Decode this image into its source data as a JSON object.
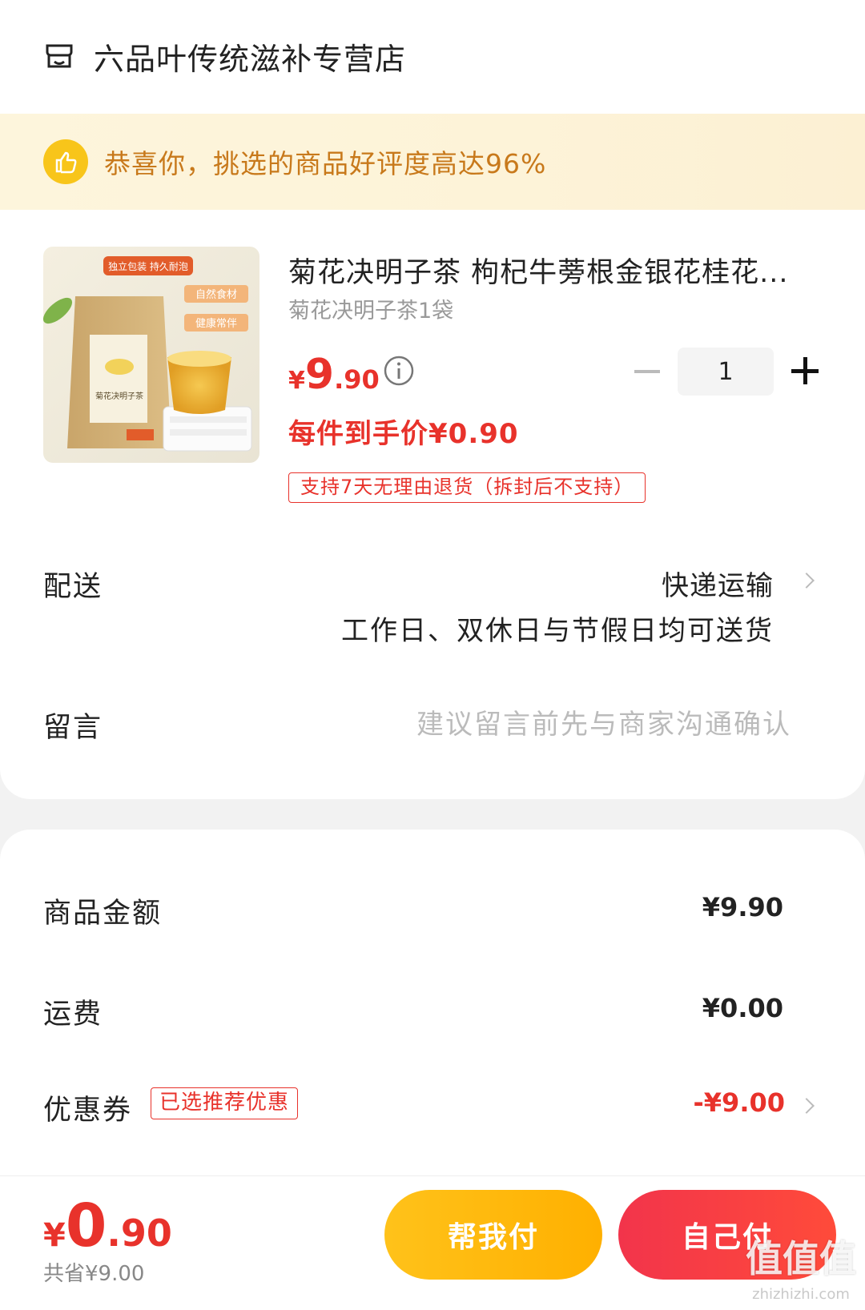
{
  "store": {
    "name": "六品叶传统滋补专营店",
    "icon": "store-icon"
  },
  "banner": {
    "text": "恭喜你，挑选的商品好评度高达96%",
    "icon": "thumbs-up-icon"
  },
  "product": {
    "title": "菊花决明子茶 枸杞牛蒡根金银花桂花...",
    "spec": "菊花决明子茶1袋",
    "price_currency": "¥",
    "price_int": "9",
    "price_dec": ".90",
    "net_price": "每件到手价¥0.90",
    "return_policy": "支持7天无理由退货（拆封后不支持）",
    "image_labels": {
      "top": "独立包装 持久耐泡",
      "tag1": "自然食材",
      "tag2": "健康常伴",
      "bag_text": "菊花决明子茶"
    },
    "quantity": "1"
  },
  "delivery": {
    "label": "配送",
    "method": "快递运输",
    "note": "工作日、双休日与节假日均可送货"
  },
  "message": {
    "label": "留言",
    "placeholder": "建议留言前先与商家沟通确认"
  },
  "summary": {
    "goods_label": "商品金额",
    "goods_value": "¥9.90",
    "shipping_label": "运费",
    "shipping_value": "¥0.00",
    "coupon_label": "优惠券",
    "coupon_tag": "已选推荐优惠",
    "coupon_value": "-¥9.00"
  },
  "footer": {
    "total_currency": "¥",
    "total_int": "0",
    "total_dec": ".90",
    "saved": "共省¥9.00",
    "help_pay": "帮我付",
    "self_pay": "自己付"
  },
  "watermark": {
    "text": "值值值",
    "url": "zhizhizhi.com"
  },
  "colors": {
    "accent_red": "#e8322b",
    "banner_text": "#c8791b",
    "help_btn": "#ffb800",
    "self_btn": "#f2344b"
  }
}
